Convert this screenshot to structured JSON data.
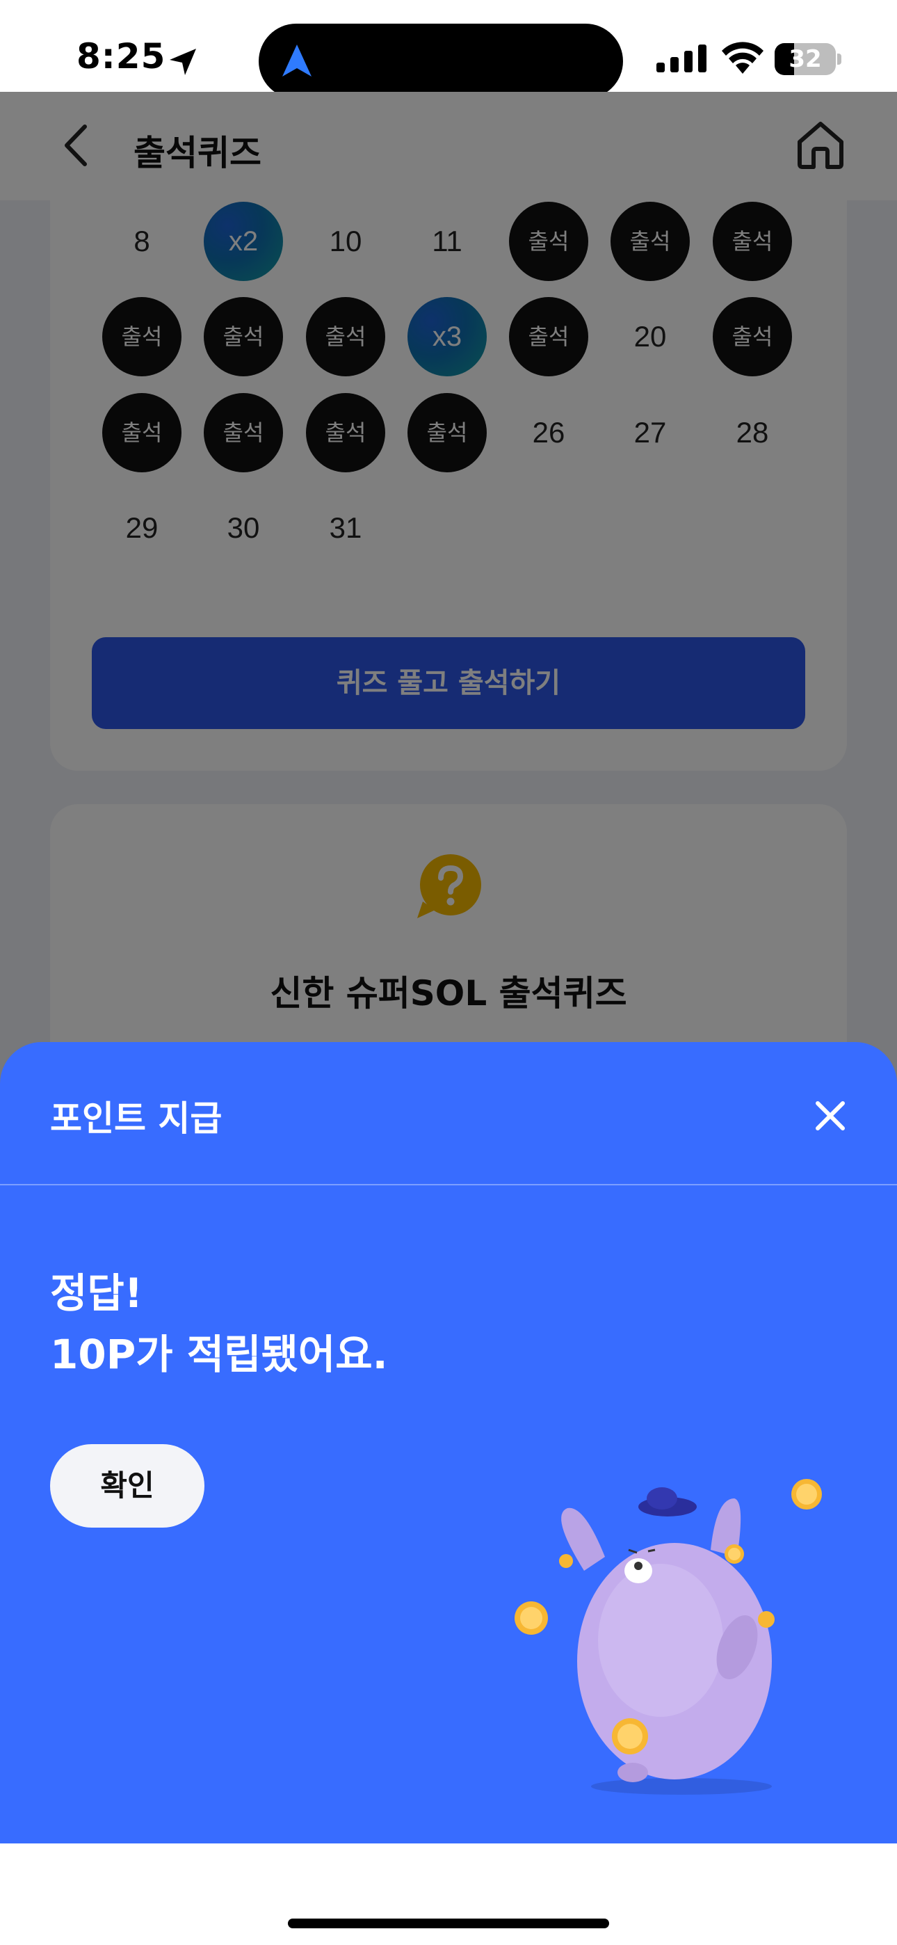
{
  "status_bar": {
    "time": "8:25",
    "battery_level": "32",
    "battery_fraction": 0.32
  },
  "header": {
    "title": "출석퀴즈",
    "back_icon": "chevron-left-icon",
    "home_icon": "home-icon"
  },
  "calendar": {
    "rows": [
      [
        {
          "label": "8",
          "state": "normal"
        },
        {
          "label": "x2",
          "state": "bonus"
        },
        {
          "label": "10",
          "state": "normal"
        },
        {
          "label": "11",
          "state": "normal"
        },
        {
          "label": "출석",
          "state": "attended"
        },
        {
          "label": "출석",
          "state": "attended"
        },
        {
          "label": "출석",
          "state": "attended"
        }
      ],
      [
        {
          "label": "출석",
          "state": "attended"
        },
        {
          "label": "출석",
          "state": "attended"
        },
        {
          "label": "출석",
          "state": "attended"
        },
        {
          "label": "x3",
          "state": "bonus"
        },
        {
          "label": "출석",
          "state": "attended"
        },
        {
          "label": "20",
          "state": "normal"
        },
        {
          "label": "출석",
          "state": "attended"
        }
      ],
      [
        {
          "label": "출석",
          "state": "attended"
        },
        {
          "label": "출석",
          "state": "attended"
        },
        {
          "label": "출석",
          "state": "attended"
        },
        {
          "label": "출석",
          "state": "attended"
        },
        {
          "label": "26",
          "state": "normal"
        },
        {
          "label": "27",
          "state": "normal"
        },
        {
          "label": "28",
          "state": "normal"
        }
      ],
      [
        {
          "label": "29",
          "state": "normal"
        },
        {
          "label": "30",
          "state": "normal"
        },
        {
          "label": "31",
          "state": "normal"
        }
      ]
    ],
    "attend_button": "퀴즈 풀고 출석하기"
  },
  "quiz_card": {
    "icon": "question-bubble-icon",
    "title": "신한 슈퍼SOL 출석퀴즈"
  },
  "sheet": {
    "title": "포인트 지급",
    "message_line1": "정답!",
    "message_line2": "10P가 적립됐어요.",
    "confirm_button": "확인",
    "colors": {
      "background": "#386cff",
      "accent_button": "#2d57e6",
      "quiz_icon": "#f5b800"
    }
  }
}
